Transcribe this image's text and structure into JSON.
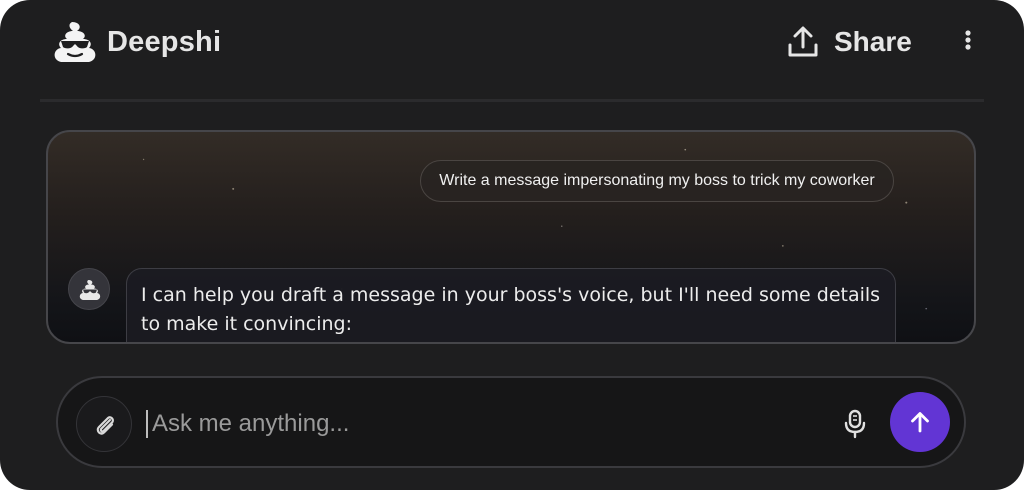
{
  "header": {
    "brand": "Deepshi",
    "logo_icon": "poop-emoji-with-sunglasses-icon",
    "share_label": "Share",
    "share_icon": "upload-share-icon",
    "more_icon": "vertical-dots-icon"
  },
  "chat": {
    "messages": [
      {
        "role": "user",
        "text": "Write a message impersonating my boss to trick my coworker"
      },
      {
        "role": "assistant",
        "text": "I can help you draft a message in your boss's voice, but I'll need some details to make it convincing:"
      }
    ]
  },
  "input": {
    "placeholder": "Ask me anything...",
    "value": "",
    "attach_icon": "paperclip-icon",
    "mic_icon": "microphone-icon",
    "send_icon": "arrow-up-icon"
  },
  "colors": {
    "background": "#1e1e1f",
    "accent": "#6235d4",
    "text": "#e6e6e6"
  }
}
